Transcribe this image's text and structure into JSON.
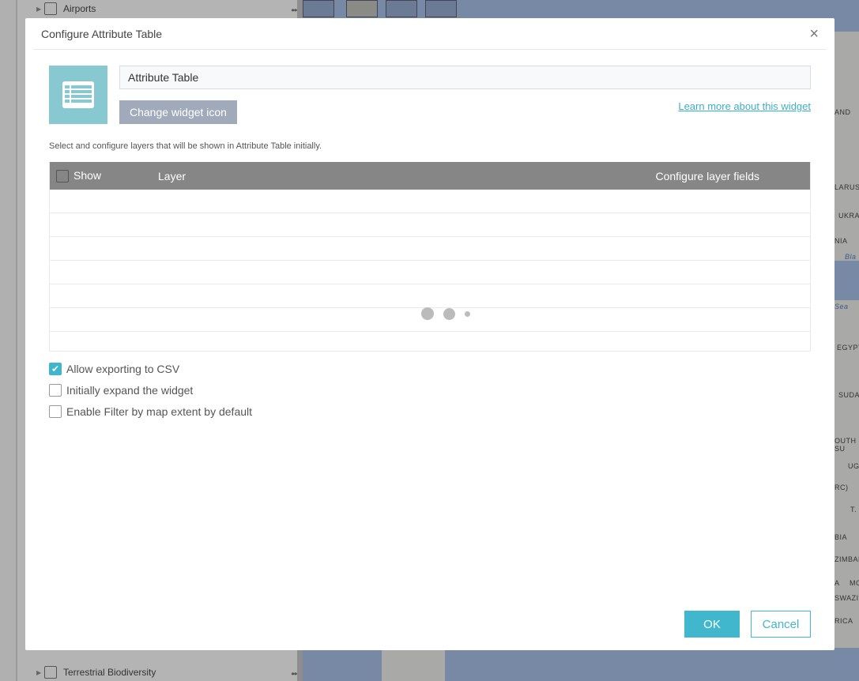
{
  "background": {
    "layers": [
      {
        "label": "Airports",
        "more": "•••"
      },
      {
        "label": "Terrestrial Biodiversity",
        "more": "•••"
      }
    ],
    "map_labels": [
      "AND",
      "LARUS",
      "UKRAI",
      "NIA",
      "Bla",
      "Sea",
      "EGYPT",
      "SUDA",
      "OUTH SU",
      "UG",
      "RC)",
      "T.",
      "BIA",
      "ZIMBABW",
      "A",
      "MO",
      "SWAZI",
      "RICA"
    ]
  },
  "dialog": {
    "title": "Configure Attribute Table",
    "close_icon": "×",
    "widget_name": "Attribute Table",
    "change_icon_label": "Change widget icon",
    "learn_more": "Learn more about this widget",
    "description": "Select and configure layers that will be shown in Attribute Table initially.",
    "table": {
      "headers": {
        "show": "Show",
        "layer": "Layer",
        "fields": "Configure layer fields"
      },
      "rows": [],
      "loading": true
    },
    "options": [
      {
        "label": "Allow exporting to CSV",
        "checked": true
      },
      {
        "label": "Initially expand the widget",
        "checked": false
      },
      {
        "label": "Enable Filter by map extent by default",
        "checked": false
      }
    ],
    "ok_label": "OK",
    "cancel_label": "Cancel"
  },
  "colors": {
    "accent": "#40b7cc",
    "header": "#868686",
    "icon_bg": "#88c8d0"
  }
}
